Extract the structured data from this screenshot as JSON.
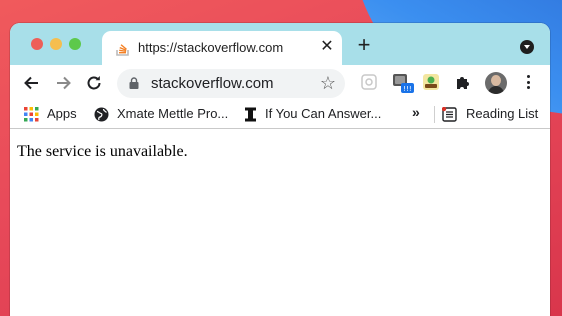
{
  "tab": {
    "title": "https://stackoverflow.com",
    "favicon": "stackoverflow-icon"
  },
  "omnibox": {
    "url": "stackoverflow.com"
  },
  "bookmarks": {
    "items": [
      {
        "label": "Apps",
        "icon": "apps-grid-icon"
      },
      {
        "label": "Xmate Mettle Pro...",
        "icon": "globe-icon"
      },
      {
        "label": "If You Can Answer...",
        "icon": "bookmark-i-icon"
      }
    ],
    "overflow": "»",
    "reading_list": "Reading List"
  },
  "page": {
    "message": "The service is unavailable."
  },
  "colors": {
    "titlebar": "#a8dfe9",
    "close": "#ed5f58",
    "minimize": "#f5be4f",
    "maximize": "#5dc94b"
  }
}
